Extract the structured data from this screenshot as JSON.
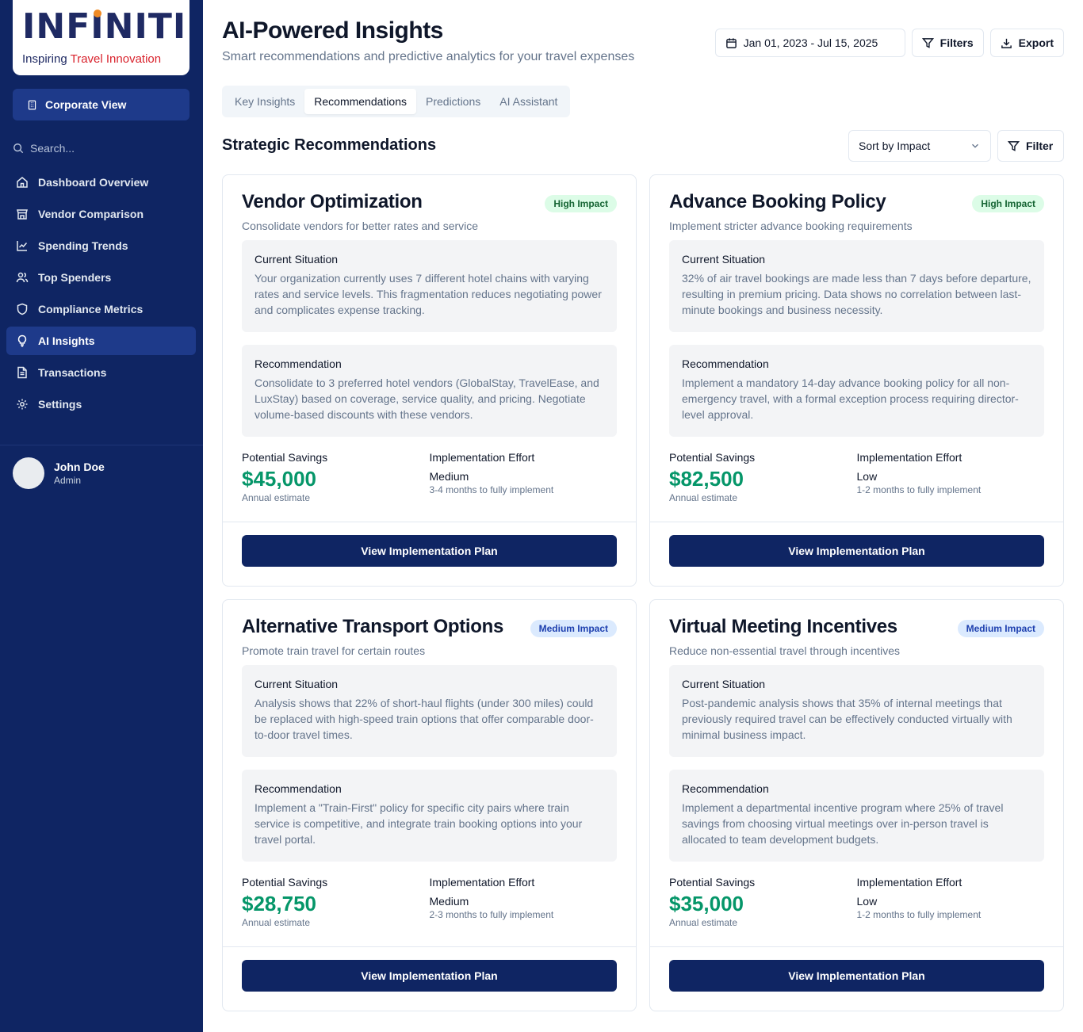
{
  "brand": {
    "name": "INFINITI",
    "tagline_a": "Inspiring ",
    "tagline_b": "Travel Innovation",
    "accent": "#d9232d"
  },
  "sidebar": {
    "view_button": "Corporate View",
    "search_placeholder": "Search...",
    "items": [
      {
        "label": "Dashboard Overview",
        "icon": "home-icon"
      },
      {
        "label": "Vendor Comparison",
        "icon": "store-icon"
      },
      {
        "label": "Spending Trends",
        "icon": "line-chart-icon"
      },
      {
        "label": "Top Spenders",
        "icon": "users-icon"
      },
      {
        "label": "Compliance Metrics",
        "icon": "shield-icon"
      },
      {
        "label": "AI Insights",
        "icon": "lightbulb-icon",
        "active": true
      },
      {
        "label": "Transactions",
        "icon": "file-text-icon"
      },
      {
        "label": "Settings",
        "icon": "gear-icon"
      }
    ],
    "user": {
      "name": "John Doe",
      "role": "Admin"
    }
  },
  "header": {
    "title": "AI-Powered Insights",
    "subtitle": "Smart recommendations and predictive analytics for your travel expenses",
    "date_range": "Jan 01, 2023 - Jul 15, 2025",
    "filters_label": "Filters",
    "export_label": "Export"
  },
  "tabs": [
    {
      "label": "Key Insights"
    },
    {
      "label": "Recommendations",
      "active": true
    },
    {
      "label": "Predictions"
    },
    {
      "label": "AI Assistant"
    }
  ],
  "section": {
    "title": "Strategic Recommendations",
    "sort_value": "Sort by Impact",
    "filter_label": "Filter"
  },
  "cards": [
    {
      "title": "Vendor Optimization",
      "badge": "High Impact",
      "subtitle": "Consolidate vendors for better rates and service",
      "situation_heading": "Current Situation",
      "situation": "Your organization currently uses 7 different hotel chains with varying rates and service levels. This fragmentation reduces negotiating power and complicates expense tracking.",
      "recommendation_heading": "Recommendation",
      "recommendation": "Consolidate to 3 preferred hotel vendors (GlobalStay, TravelEase, and LuxStay) based on coverage, service quality, and pricing. Negotiate volume-based discounts with these vendors.",
      "savings_label": "Potential Savings",
      "savings": "$45,000",
      "savings_note": "Annual estimate",
      "effort_label": "Implementation Effort",
      "effort": "Medium",
      "effort_note": "3-4 months to fully implement",
      "button": "View Implementation Plan"
    },
    {
      "title": "Advance Booking Policy",
      "badge": "High Impact",
      "subtitle": "Implement stricter advance booking requirements",
      "situation_heading": "Current Situation",
      "situation": "32% of air travel bookings are made less than 7 days before departure, resulting in premium pricing. Data shows no correlation between last-minute bookings and business necessity.",
      "recommendation_heading": "Recommendation",
      "recommendation": "Implement a mandatory 14-day advance booking policy for all non-emergency travel, with a formal exception process requiring director-level approval.",
      "savings_label": "Potential Savings",
      "savings": "$82,500",
      "savings_note": "Annual estimate",
      "effort_label": "Implementation Effort",
      "effort": "Low",
      "effort_note": "1-2 months to fully implement",
      "button": "View Implementation Plan"
    },
    {
      "title": "Alternative Transport Options",
      "badge": "Medium Impact",
      "subtitle": "Promote train travel for certain routes",
      "situation_heading": "Current Situation",
      "situation": "Analysis shows that 22% of short-haul flights (under 300 miles) could be replaced with high-speed train options that offer comparable door-to-door travel times.",
      "recommendation_heading": "Recommendation",
      "recommendation": "Implement a \"Train-First\" policy for specific city pairs where train service is competitive, and integrate train booking options into your travel portal.",
      "savings_label": "Potential Savings",
      "savings": "$28,750",
      "savings_note": "Annual estimate",
      "effort_label": "Implementation Effort",
      "effort": "Medium",
      "effort_note": "2-3 months to fully implement",
      "button": "View Implementation Plan"
    },
    {
      "title": "Virtual Meeting Incentives",
      "badge": "Medium Impact",
      "subtitle": "Reduce non-essential travel through incentives",
      "situation_heading": "Current Situation",
      "situation": "Post-pandemic analysis shows that 35% of internal meetings that previously required travel can be effectively conducted virtually with minimal business impact.",
      "recommendation_heading": "Recommendation",
      "recommendation": "Implement a departmental incentive program where 25% of travel savings from choosing virtual meetings over in-person travel is allocated to team development budgets.",
      "savings_label": "Potential Savings",
      "savings": "$35,000",
      "savings_note": "Annual estimate",
      "effort_label": "Implementation Effort",
      "effort": "Low",
      "effort_note": "1-2 months to fully implement",
      "button": "View Implementation Plan"
    }
  ]
}
